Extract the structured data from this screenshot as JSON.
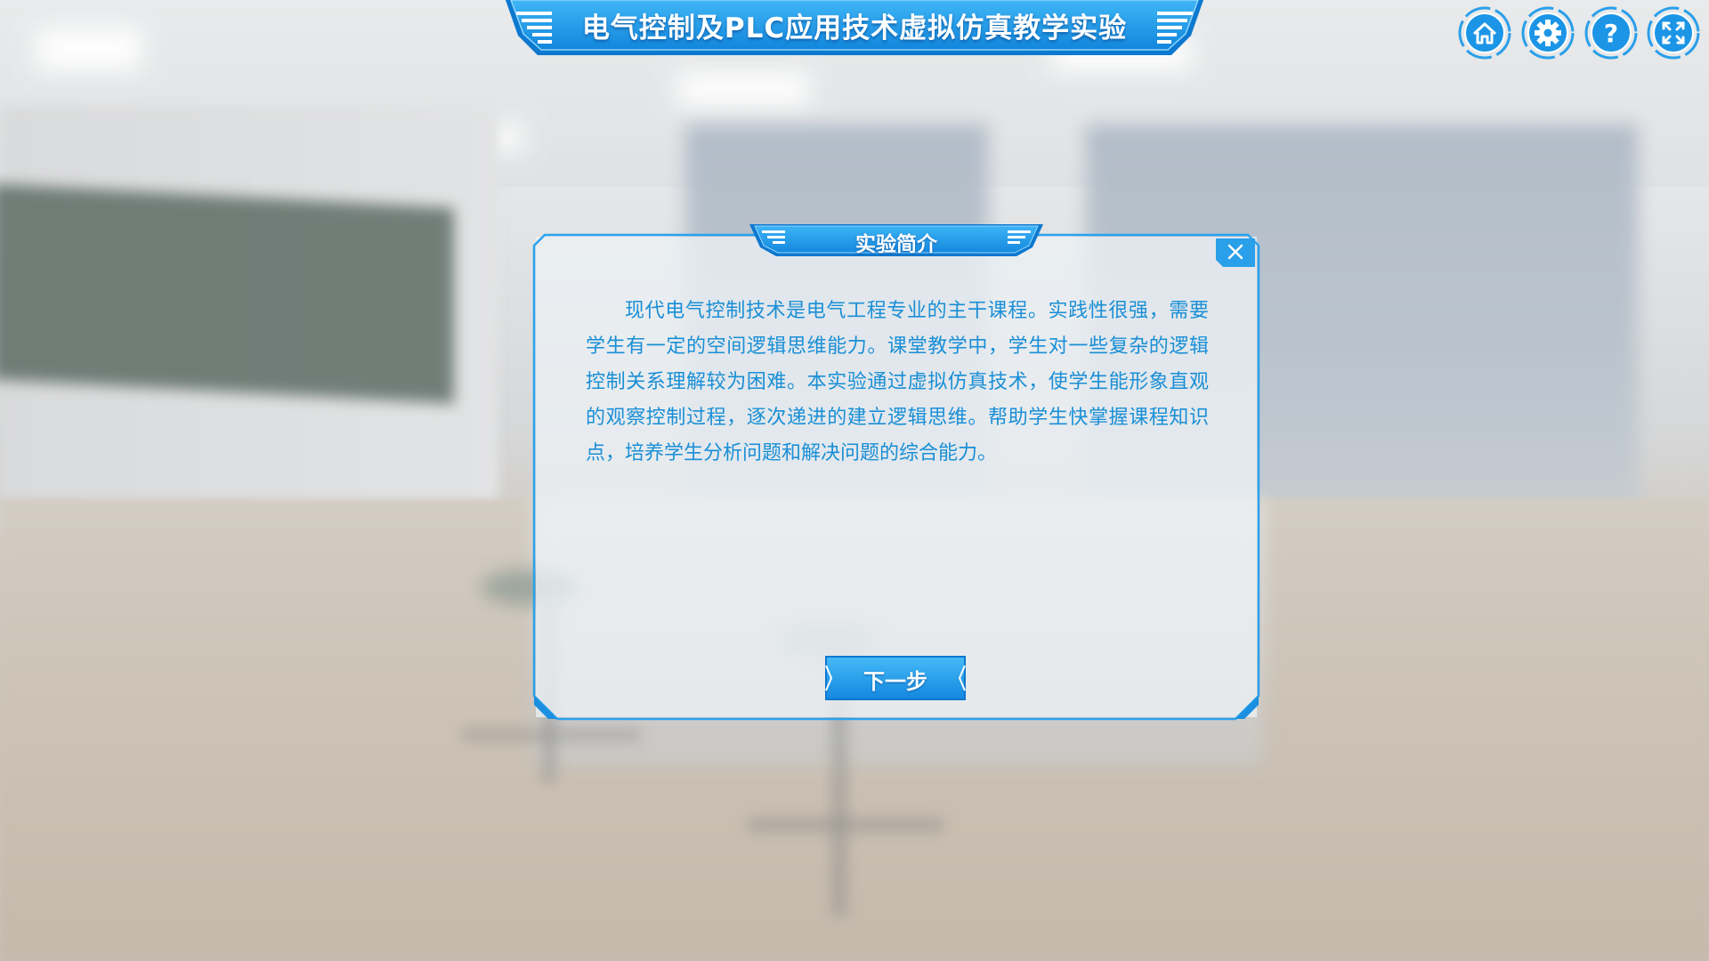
{
  "app": {
    "title": "电气控制及PLC应用技术虚拟仿真教学实验"
  },
  "toolbar": {
    "buttons": [
      {
        "icon": "home-icon"
      },
      {
        "icon": "gear-icon"
      },
      {
        "icon": "help-icon"
      },
      {
        "icon": "fullscreen-icon"
      }
    ]
  },
  "dialog": {
    "title": "实验简介",
    "body": "现代电气控制技术是电气工程专业的主干课程。实践性很强，需要学生有一定的空间逻辑思维能力。课堂教学中，学生对一些复杂的逻辑控制关系理解较为困难。本实验通过虚拟仿真技术，使学生能形象直观的观察控制过程，逐次递进的建立逻辑思维。帮助学生快掌握课程知识点，培养学生分析问题和解决问题的综合能力。",
    "next_label": "下一步",
    "close_icon": "close-icon"
  },
  "colors": {
    "accent": "#1e9ae8",
    "accent_dark": "#0b6fc4",
    "text": "#1a8fd6"
  }
}
